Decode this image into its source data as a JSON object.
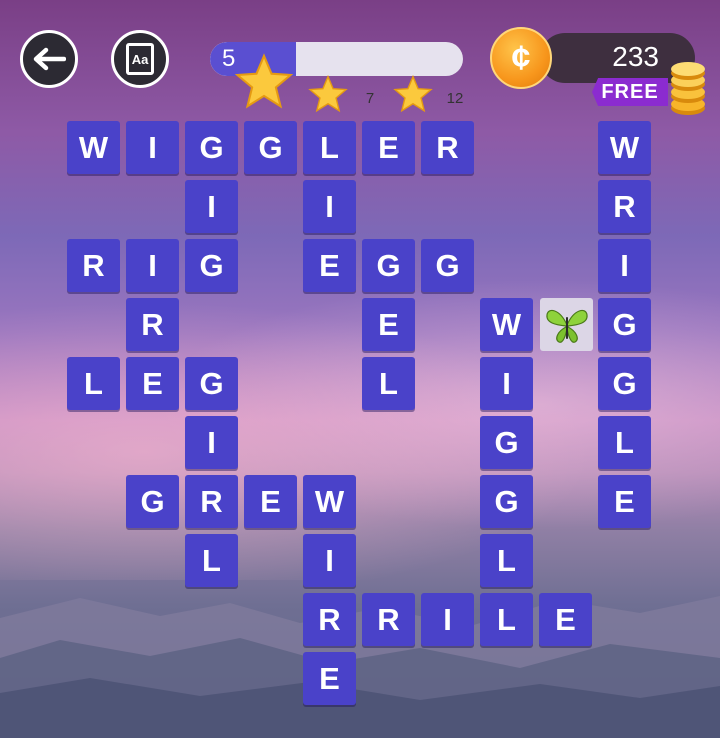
{
  "header": {
    "back_icon": "arrow-left-icon",
    "dictionary_icon": "dictionary-book-icon",
    "dictionary_label": "Aa",
    "level_progress": {
      "current": "5",
      "fill_fraction": 0.34,
      "fill_color": "#5a4fd1",
      "track_color": "#e6e2ee"
    },
    "star_milestones": [
      "",
      "7",
      "12"
    ],
    "coins": {
      "count": "233",
      "free_label": "FREE",
      "coin_symbol": "¢",
      "coin_color": "#f7961c"
    }
  },
  "board": {
    "tile_color": "#4a42c9",
    "bonus_icon": "butterfly-icon",
    "tiles": [
      {
        "letter": "W",
        "col": 0,
        "row": 0
      },
      {
        "letter": "I",
        "col": 1,
        "row": 0
      },
      {
        "letter": "G",
        "col": 2,
        "row": 0
      },
      {
        "letter": "G",
        "col": 3,
        "row": 0
      },
      {
        "letter": "L",
        "col": 4,
        "row": 0
      },
      {
        "letter": "E",
        "col": 5,
        "row": 0
      },
      {
        "letter": "R",
        "col": 6,
        "row": 0
      },
      {
        "letter": "W",
        "col": 9,
        "row": 0
      },
      {
        "letter": "I",
        "col": 2,
        "row": 1
      },
      {
        "letter": "I",
        "col": 4,
        "row": 1
      },
      {
        "letter": "R",
        "col": 9,
        "row": 1
      },
      {
        "letter": "R",
        "col": 0,
        "row": 2
      },
      {
        "letter": "I",
        "col": 1,
        "row": 2
      },
      {
        "letter": "G",
        "col": 2,
        "row": 2
      },
      {
        "letter": "E",
        "col": 4,
        "row": 2
      },
      {
        "letter": "G",
        "col": 5,
        "row": 2
      },
      {
        "letter": "G",
        "col": 6,
        "row": 2
      },
      {
        "letter": "I",
        "col": 9,
        "row": 2
      },
      {
        "letter": "R",
        "col": 1,
        "row": 3
      },
      {
        "letter": "E",
        "col": 5,
        "row": 3
      },
      {
        "letter": "W",
        "col": 7,
        "row": 3
      },
      {
        "letter": "G",
        "col": 9,
        "row": 3
      },
      {
        "letter": "L",
        "col": 0,
        "row": 4
      },
      {
        "letter": "E",
        "col": 1,
        "row": 4
      },
      {
        "letter": "G",
        "col": 2,
        "row": 4
      },
      {
        "letter": "L",
        "col": 5,
        "row": 4
      },
      {
        "letter": "I",
        "col": 7,
        "row": 4
      },
      {
        "letter": "G",
        "col": 9,
        "row": 4
      },
      {
        "letter": "I",
        "col": 2,
        "row": 5
      },
      {
        "letter": "G",
        "col": 7,
        "row": 5
      },
      {
        "letter": "L",
        "col": 9,
        "row": 5
      },
      {
        "letter": "G",
        "col": 1,
        "row": 6
      },
      {
        "letter": "R",
        "col": 2,
        "row": 6
      },
      {
        "letter": "E",
        "col": 3,
        "row": 6
      },
      {
        "letter": "W",
        "col": 4,
        "row": 6
      },
      {
        "letter": "G",
        "col": 7,
        "row": 6
      },
      {
        "letter": "E",
        "col": 9,
        "row": 6
      },
      {
        "letter": "L",
        "col": 2,
        "row": 7
      },
      {
        "letter": "I",
        "col": 4,
        "row": 7
      },
      {
        "letter": "L",
        "col": 7,
        "row": 7
      },
      {
        "letter": "R",
        "col": 4,
        "row": 8
      },
      {
        "letter": "R",
        "col": 5,
        "row": 8
      },
      {
        "letter": "I",
        "col": 6,
        "row": 8
      },
      {
        "letter": "L",
        "col": 7,
        "row": 8
      },
      {
        "letter": "E",
        "col": 8,
        "row": 8
      },
      {
        "letter": "E",
        "col": 4,
        "row": 9
      }
    ]
  }
}
